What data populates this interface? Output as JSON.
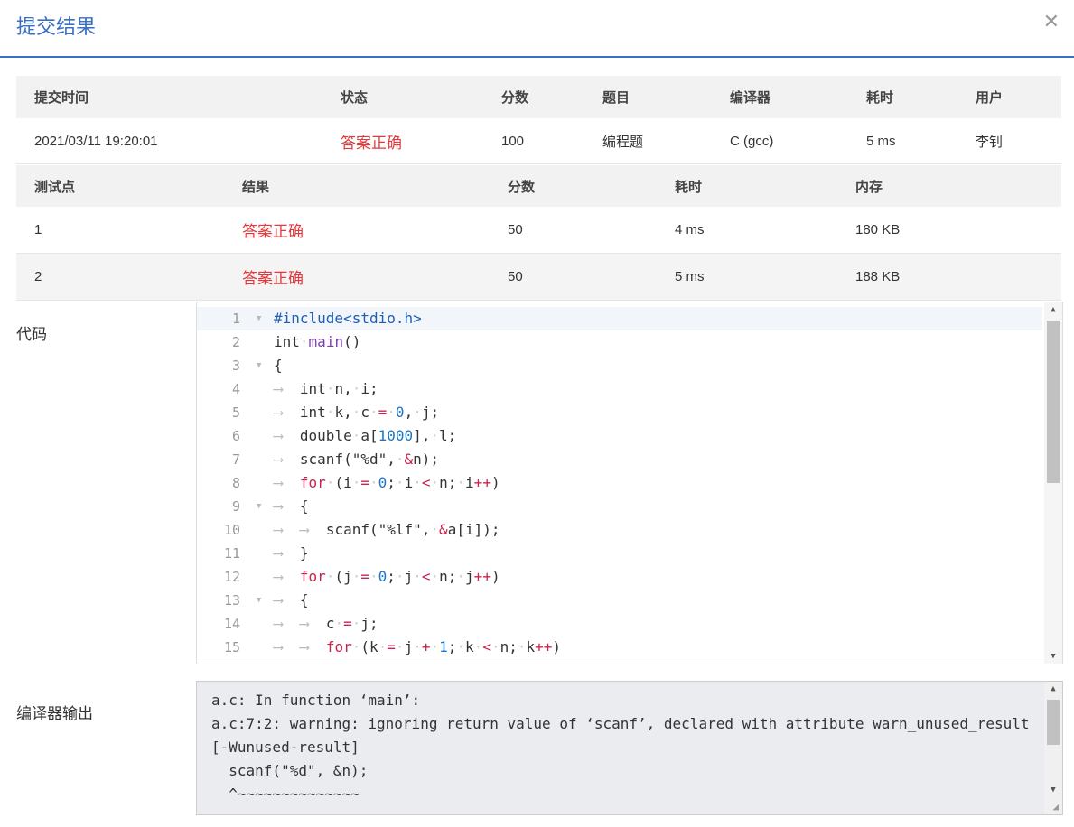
{
  "dialog": {
    "title": "提交结果",
    "close_icon": "✕"
  },
  "summary": {
    "headers": [
      "提交时间",
      "状态",
      "分数",
      "题目",
      "编译器",
      "耗时",
      "用户"
    ],
    "row": [
      "2021/03/11 19:20:01",
      "答案正确",
      "100",
      "编程题",
      "C (gcc)",
      "5 ms",
      "李钊"
    ]
  },
  "tests": {
    "headers": [
      "测试点",
      "结果",
      "分数",
      "耗时",
      "内存"
    ],
    "rows": [
      [
        "1",
        "答案正确",
        "50",
        "4 ms",
        "180 KB"
      ],
      [
        "2",
        "答案正确",
        "50",
        "5 ms",
        "188 KB"
      ]
    ]
  },
  "code": {
    "label": "代码",
    "line_numbers": [
      "1",
      "2",
      "3",
      "4",
      "5",
      "6",
      "7",
      "8",
      "9",
      "10",
      "11",
      "12",
      "13",
      "14",
      "15"
    ],
    "lines": [
      "#include<stdio.h>",
      "int main()",
      "{",
      "int n, i;",
      "int k, c = 0, j;",
      "double a[1000], l;",
      "scanf(\"%d\", &n);",
      "for (i = 0; i < n; i++)",
      "{",
      "scanf(\"%lf\", &a[i]);",
      "}",
      "for (j = 0; j < n; j++)",
      "{",
      "c = j;",
      "for (k = j + 1; k < n; k++)"
    ]
  },
  "compiler_output": {
    "label": "编译器输出",
    "lines": [
      "a.c: In function ‘main’:",
      "a.c:7:2: warning: ignoring return value of ‘scanf’, declared with attribute warn_unused_result",
      "[-Wunused-result]",
      "  scanf(\"%d\", &n);",
      "  ^~~~~~~~~~~~~~~"
    ]
  },
  "colors": {
    "accent": "#3a6fc4",
    "ok": "#e4393c"
  }
}
